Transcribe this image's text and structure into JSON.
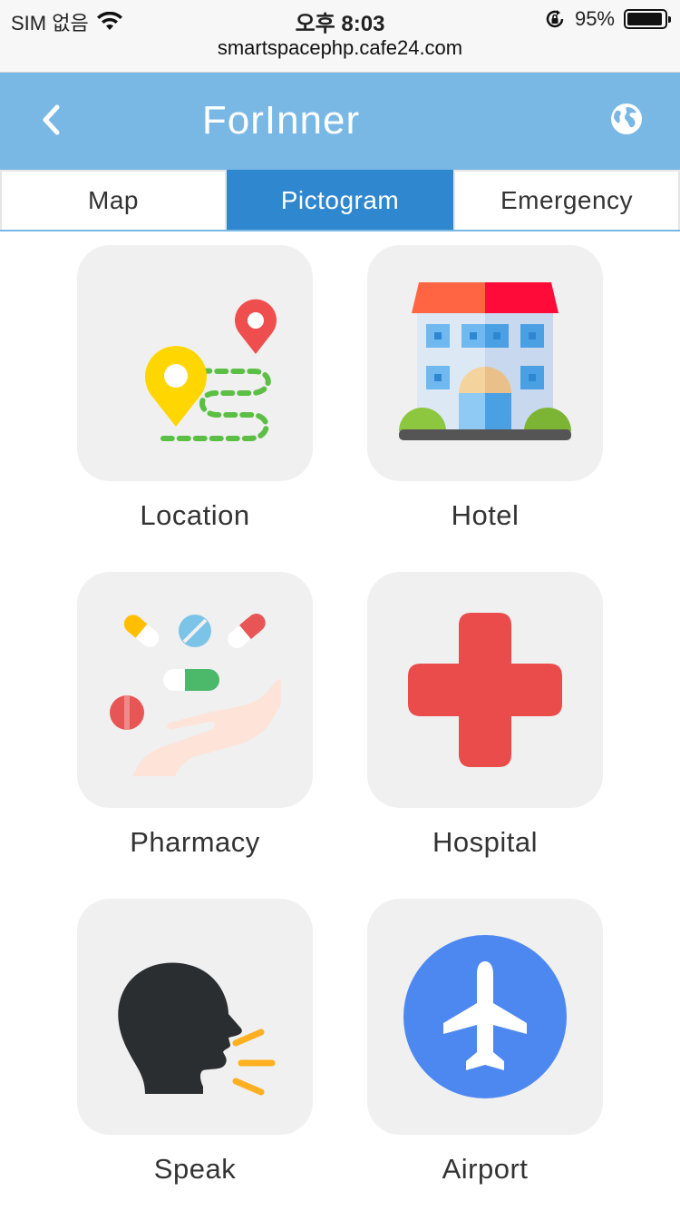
{
  "status_bar": {
    "carrier": "SIM 없음",
    "time": "오후 8:03",
    "battery_percent": "95%",
    "battery_level": 0.95,
    "url": "smartspacephp.cafe24.com",
    "icons": [
      "wifi-icon",
      "orientation-lock-icon",
      "battery-icon"
    ]
  },
  "header": {
    "title": "ForInner",
    "back_icon": "chevron-left-icon",
    "language_icon": "globe-icon",
    "background": "#79b8e5"
  },
  "tabs": [
    {
      "label": "Map",
      "active": false
    },
    {
      "label": "Pictogram",
      "active": true
    },
    {
      "label": "Emergency",
      "active": false
    }
  ],
  "colors": {
    "accent": "#2f87cf",
    "tile_bg": "#f0f0f0"
  },
  "pictograms": [
    {
      "label": "Location",
      "icon": "location-route-icon"
    },
    {
      "label": "Hotel",
      "icon": "hotel-building-icon"
    },
    {
      "label": "Pharmacy",
      "icon": "pills-hand-icon"
    },
    {
      "label": "Hospital",
      "icon": "red-cross-icon"
    },
    {
      "label": "Speak",
      "icon": "speaking-head-icon"
    },
    {
      "label": "Airport",
      "icon": "airplane-icon"
    }
  ]
}
